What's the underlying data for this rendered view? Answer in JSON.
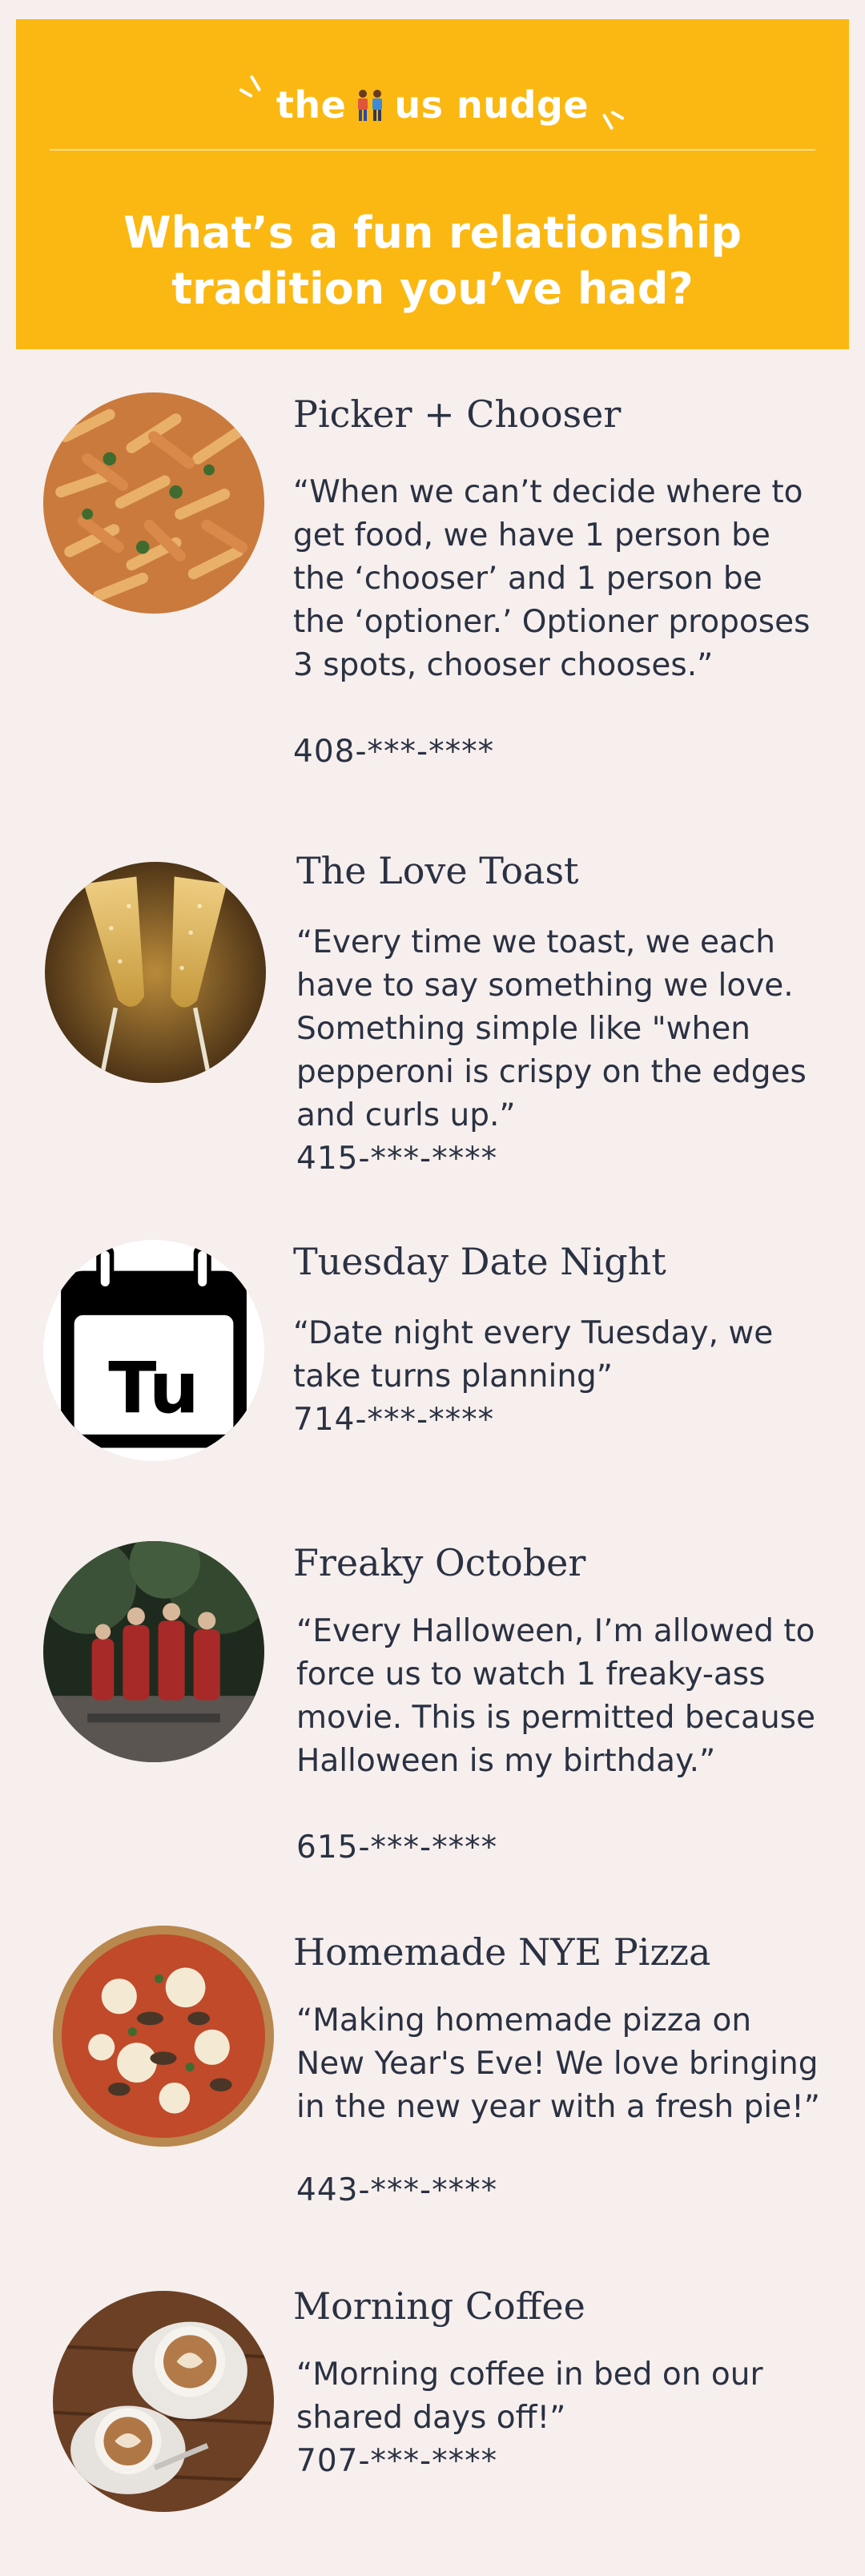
{
  "header": {
    "brand_prefix": "the",
    "brand_suffix": "us nudge",
    "brand_icon": "two-people-icon",
    "question_line1": "What’s a fun relationship",
    "question_line2": "tradition you’ve had?",
    "colors": {
      "banner": "#fbb812",
      "text": "#ffffff"
    }
  },
  "items": [
    {
      "title": "Picker + Chooser",
      "quote": "“When we can’t decide where to get food, we have 1 person be the ‘chooser’ and 1 person be the ‘optioner.’ Optioner proposes 3 spots, chooser chooses.”",
      "phone": "408-***-****",
      "image": "pasta-image"
    },
    {
      "title": "The Love Toast",
      "quote": "“Every time we toast, we each have to say something we love. Something simple like \"when pepperoni is crispy on the edges and curls up.”",
      "phone": "415-***-****",
      "image": "champagne-image"
    },
    {
      "title": "Tuesday Date Night",
      "quote": "“Date night every Tuesday, we take turns planning”",
      "phone": "714-***-****",
      "image": "calendar-icon",
      "calendar_label": "Tu"
    },
    {
      "title": "Freaky October",
      "quote": "“Every Halloween, I’m allowed to force us to watch 1 freaky-ass movie. This is permitted because Halloween is my birthday.”",
      "phone": "615-***-****",
      "image": "halloween-image"
    },
    {
      "title": "Homemade NYE Pizza",
      "quote": "“Making homemade pizza on New Year's Eve! We love bringing in the new year with a fresh pie!”",
      "phone": "443-***-****",
      "image": "pizza-image"
    },
    {
      "title": "Morning Coffee",
      "quote": "“Morning coffee in bed on our shared days off!”",
      "phone": "707-***-****",
      "image": "coffee-image"
    }
  ]
}
